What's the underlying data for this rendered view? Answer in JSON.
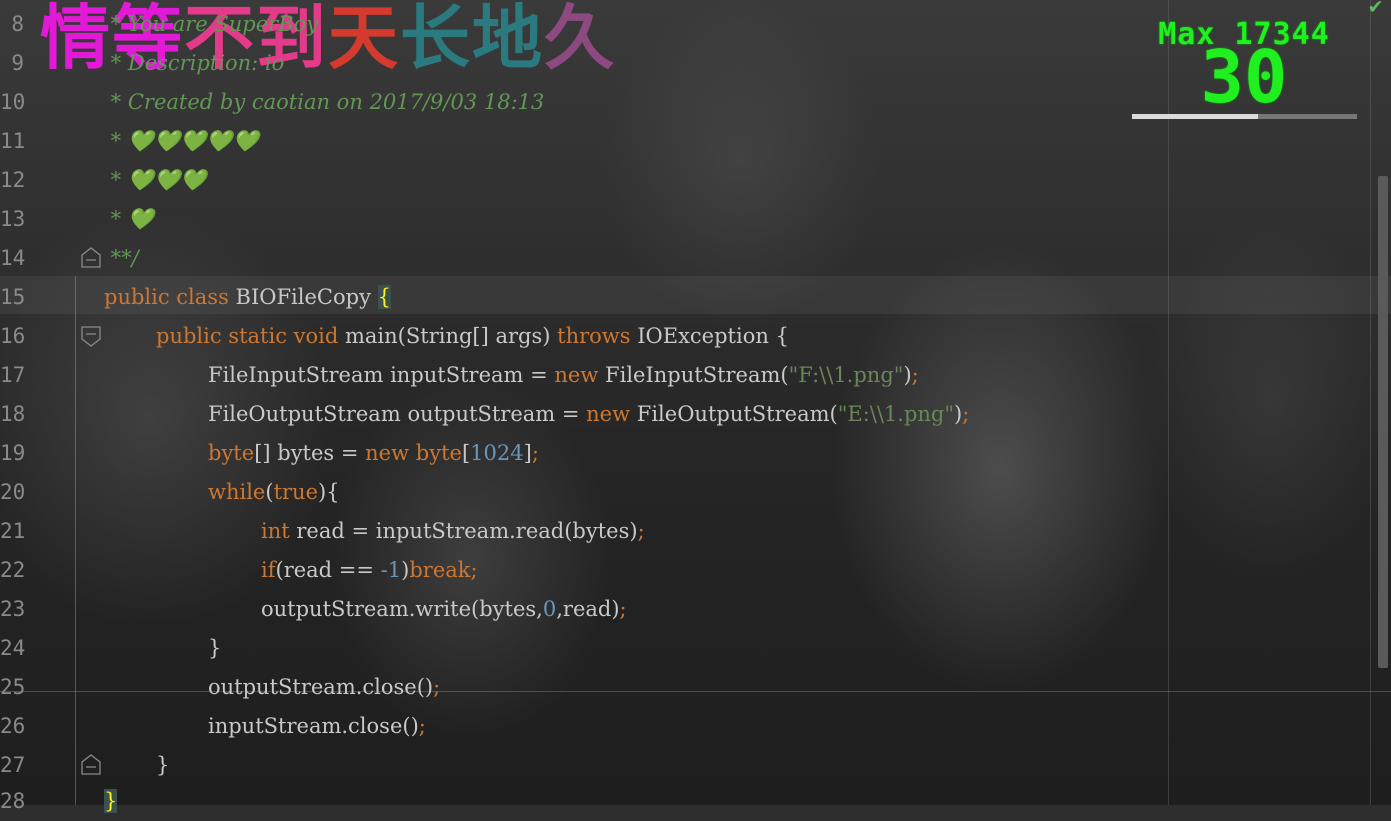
{
  "banner": {
    "parts": [
      "情",
      "等",
      "不",
      "到",
      "天",
      "长",
      "地",
      "久"
    ]
  },
  "combo": {
    "max_label": "Max 17344",
    "count": "30",
    "progress": 0.56
  },
  "status": {
    "check_icon": "check-icon",
    "color": "#5fb85f"
  },
  "editor": {
    "line_numbers": [
      "8",
      "9",
      "10",
      "11",
      "12",
      "13",
      "14",
      "15",
      "16",
      "17",
      "18",
      "19",
      "20",
      "21",
      "22",
      "23",
      "24",
      "25",
      "26",
      "27",
      "28"
    ],
    "comment": {
      "l8": " * You are SuperBoy",
      "l9": " * Description: io",
      "l10": " * Created by caotian on 2017/9/03 18:13",
      "l11": " * 💚💚💚💚💚",
      "l12": " * 💚💚💚",
      "l13": " * 💚",
      "l14": " **/"
    },
    "tokens": {
      "public": "public",
      "class": "class",
      "class_name": "BIOFileCopy",
      "open_brace": "{",
      "static": "static",
      "void": "void",
      "main_sig": "main(String[] args)",
      "throws": "throws",
      "ioexception": "IOException",
      "fis_type": "FileInputStream",
      "fis_var": "inputStream",
      "new": "new",
      "fis_ctor": "FileInputStream(",
      "fis_path": "\"F:\\\\1.png\"",
      "fos_type": "FileOutputStream",
      "fos_var": "outputStream",
      "fos_ctor": "FileOutputStream(",
      "fos_path": "\"E:\\\\1.png\"",
      "byte": "byte",
      "bytes_decl": "[] bytes = ",
      "size": "1024",
      "while": "while",
      "true": "true",
      "int": "int",
      "read_decl": " read = inputStream.read(bytes)",
      "if": "if",
      "cond": "(read == ",
      "minus_one": "-1",
      "break": "break",
      "write_call": "outputStream.write(bytes,",
      "zero": "0",
      "read_arg": "read)",
      "close_out": "outputStream.close()",
      "close_in": "inputStream.close()",
      "semicolon": ";",
      "close_brace": "}"
    }
  }
}
